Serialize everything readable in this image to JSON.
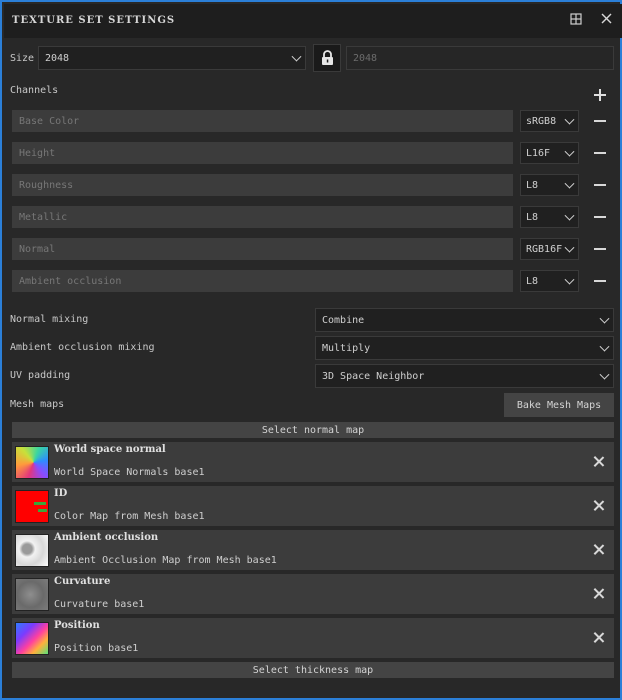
{
  "window": {
    "title": "TEXTURE SET SETTINGS"
  },
  "size": {
    "label": "Size",
    "value": "2048",
    "linked_value": "2048"
  },
  "channels": {
    "label": "Channels",
    "items": [
      {
        "name": "Base Color",
        "format": "sRGB8"
      },
      {
        "name": "Height",
        "format": "L16F"
      },
      {
        "name": "Roughness",
        "format": "L8"
      },
      {
        "name": "Metallic",
        "format": "L8"
      },
      {
        "name": "Normal",
        "format": "RGB16F"
      },
      {
        "name": "Ambient occlusion",
        "format": "L8"
      }
    ]
  },
  "settings": {
    "normal_mixing_label": "Normal mixing",
    "normal_mixing_value": "Combine",
    "ao_mixing_label": "Ambient occlusion mixing",
    "ao_mixing_value": "Multiply",
    "uv_padding_label": "UV padding",
    "uv_padding_value": "3D Space Neighbor"
  },
  "mesh_maps": {
    "label": "Mesh maps",
    "bake_button": "Bake Mesh Maps",
    "select_normal": "Select normal map",
    "select_thickness": "Select thickness map",
    "items": [
      {
        "title": "World space normal",
        "source": "World Space Normals base1"
      },
      {
        "title": "ID",
        "source": "Color Map from Mesh base1"
      },
      {
        "title": "Ambient occlusion",
        "source": "Ambient Occlusion Map from Mesh base1"
      },
      {
        "title": "Curvature",
        "source": "Curvature base1"
      },
      {
        "title": "Position",
        "source": "Position base1"
      }
    ]
  },
  "colors": {
    "accent_border": "#2b7fd8",
    "id_map": "#ff0000"
  }
}
